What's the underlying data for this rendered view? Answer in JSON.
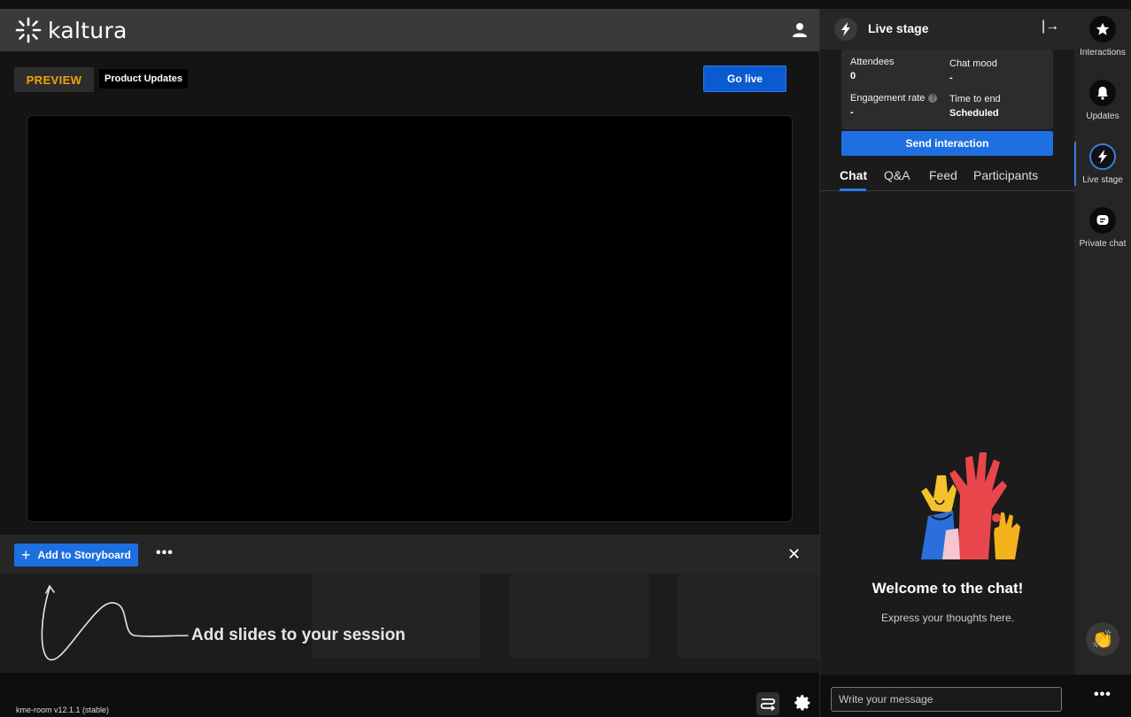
{
  "brand": {
    "name": "kaltura"
  },
  "header": {
    "user_icon": "user-icon"
  },
  "preview": {
    "badge": "PREVIEW",
    "session_title": "Product Updates",
    "go_live_label": "Go live"
  },
  "storyboard": {
    "add_label": "Add to Storyboard",
    "more_label": "•••",
    "close_label": "✕",
    "hint": "Add slides to your session"
  },
  "footer": {
    "version": "kme-room v12.1.1 (stable)"
  },
  "live_stage": {
    "title": "Live stage",
    "exit_label": "|→",
    "stats": {
      "attendees_label": "Attendees",
      "attendees_value": "0",
      "chat_mood_label": "Chat mood",
      "chat_mood_value": "-",
      "engagement_label": "Engagement rate",
      "engagement_value": "-",
      "time_to_end_label": "Time to end",
      "time_to_end_value": "Scheduled"
    },
    "send_interaction_label": "Send interaction",
    "tabs": [
      "Chat",
      "Q&A",
      "Feed",
      "Participants"
    ],
    "active_tab": "Chat",
    "welcome_title": "Welcome to the chat!",
    "welcome_sub": "Express your thoughts here.",
    "message_placeholder": "Write your message"
  },
  "rail": {
    "items": [
      {
        "label": "Interactions",
        "icon": "star-icon"
      },
      {
        "label": "Updates",
        "icon": "bell-icon"
      },
      {
        "label": "Live stage",
        "icon": "bolt-icon"
      },
      {
        "label": "Private chat",
        "icon": "chat-bubble-icon"
      }
    ],
    "active": "Live stage",
    "more_label": "•••"
  },
  "colors": {
    "accent_blue": "#1e6fe0",
    "preview_orange": "#f0a30a",
    "topbar": "#3a3a38"
  }
}
